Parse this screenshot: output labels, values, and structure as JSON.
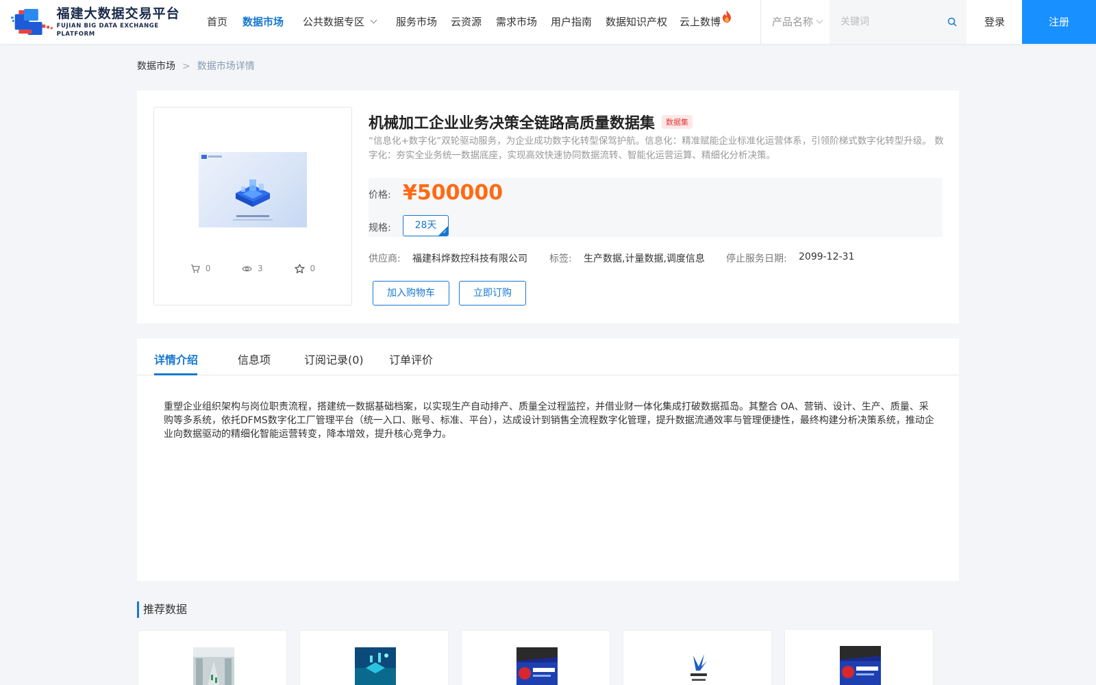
{
  "header": {
    "logo_cn": "福建大数据交易平台",
    "logo_en": "FUJIAN BIG DATA EXCHANGE  PLATFORM",
    "nav": [
      {
        "label": "首页"
      },
      {
        "label": "数据市场"
      },
      {
        "label": "公共数据专区"
      },
      {
        "label": "服务市场"
      },
      {
        "label": "云资源"
      },
      {
        "label": "需求市场"
      },
      {
        "label": "用户指南"
      },
      {
        "label": "数据知识产权"
      },
      {
        "label": "云上数博"
      }
    ],
    "active_nav": "数据市场",
    "search_type": "产品名称",
    "search_placeholder": "关键词",
    "login": "登录",
    "register": "注册"
  },
  "breadcrumb": {
    "root": "数据市场",
    "separator": ">",
    "current": "数据市场详情"
  },
  "product": {
    "title": "机械加工企业业务决策全链路高质量数据集",
    "tag": "数据集",
    "description": "“信息化+数字化”双轮驱动服务，为企业成功数字化转型保驾护航。信息化：精准赋能企业标准化运营体系，引领阶梯式数字化转型升级。 数字化：夯实全业务统一数据底座，实现高效快速协同数据流转、智能化运营运算、精细化分析决策。",
    "price_label": "价格:",
    "price": "¥500000",
    "spec_label": "规格:",
    "spec_option": "28天",
    "supplier_label": "供应商:",
    "supplier": "福建科烨数控科技有限公司",
    "tags_label": "标签:",
    "tags": "生产数据,计量数据,调度信息",
    "stop_date_label": "停止服务日期:",
    "stop_date": "2099-12-31",
    "add_cart": "加入购物车",
    "buy_now": "立即订购",
    "stats": {
      "cart_count": "0",
      "view_count": "3",
      "fav_count": "0"
    }
  },
  "tabs": [
    {
      "label": "详情介绍"
    },
    {
      "label": "信息项"
    },
    {
      "label": "订阅记录(0)"
    },
    {
      "label": "订单评价"
    }
  ],
  "active_tab": "详情介绍",
  "detail_text": "重塑企业组织架构与岗位职责流程，搭建统一数据基础档案，以实现生产自动排产、质量全过程监控，并借业财一体化集成打破数据孤岛。其整合 OA、营销、设计、生产、质量、采购等多系统，依托DFMS数字化工厂管理平台（统一入口、账号、标准、平台），达成设计到销售全流程数字化管理，提升数据流通效率与管理便捷性，最终构建分析决策系统，推动企业向数据驱动的精细化智能运营转变，降本增效，提升核心竞争力。",
  "recommend": {
    "title": "推荐数据",
    "items": [
      {
        "image": "factory-photo"
      },
      {
        "image": "data-tech-illustration"
      },
      {
        "image": "jinpan-tech-logo"
      },
      {
        "image": "zolink-logo"
      },
      {
        "image": "jinpan-tech-logo"
      }
    ]
  },
  "colors": {
    "primary": "#1677d2",
    "register_bg": "#1890ff",
    "price": "#ff6a13",
    "tag_text": "#e23c3c",
    "tag_bg": "#fde7e7",
    "page_bg": "#f3f5f8"
  }
}
